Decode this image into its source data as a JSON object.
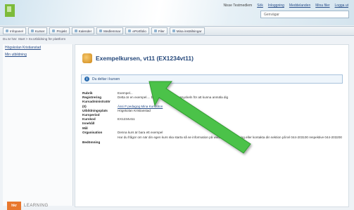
{
  "header": {
    "top_links": [
      "Nisse Testmedlem",
      "Sök",
      "Inloggning",
      "Meddelanden",
      "Mina filer",
      "Logga ut"
    ],
    "search_placeholder": "Genvägar"
  },
  "nav": {
    "tabs": [
      "Infopanel",
      "Kurser",
      "Projekt",
      "Kalender",
      "Medlemmar",
      "ePortfolio",
      "Filer",
      "Mina inställningar"
    ]
  },
  "breadcrumb": "Du är här: Start > Sv.Utbildning för plattform",
  "sidebar": {
    "links": [
      "Högskolan Kristianstad",
      "Min utbildning"
    ]
  },
  "brand": {
    "mark": "hkr",
    "text": "LEARNING"
  },
  "main": {
    "title": "Exempelkursen, vt11 (EX1234vt11)",
    "info_text": "Du deltar i kursen",
    "details": [
      {
        "key": "Rubrik",
        "value": "Exempel..."
      },
      {
        "key": "Registrering",
        "value": "Detta är en exempel.... behöver registreringsnyckeln för att kunna anmäla dig"
      },
      {
        "key": "Kursadministratör",
        "value": ""
      },
      {
        "key": "(0)",
        "value": "Ässi P pedagog  Mina Kursfoton"
      },
      {
        "key": "Utbildningsplats",
        "value": "Högskolan Kristianstad"
      },
      {
        "key": "Kursperiod",
        "value": ""
      },
      {
        "key": "Kurskod",
        "value": "EX1234vt11"
      },
      {
        "key": "Innehåll",
        "value": ""
      },
      {
        "key": "Mål",
        "value": ""
      },
      {
        "key": "Organisation",
        "value": "Denna kurs är bara ett exempel"
      },
      {
        "key": "",
        "value": "Har du frågor om när din egen kurs ska starta så se information på www.hkr.se/utbildning eller kontakta din sektion på tel 044-203100 respektive 044-203200"
      },
      {
        "key": "Bedömning",
        "value": ""
      }
    ]
  },
  "colors": {
    "accent": "#24477a",
    "arrow": "#4cc24a",
    "logo": "#7dbb3a",
    "brand": "#e8782e"
  }
}
